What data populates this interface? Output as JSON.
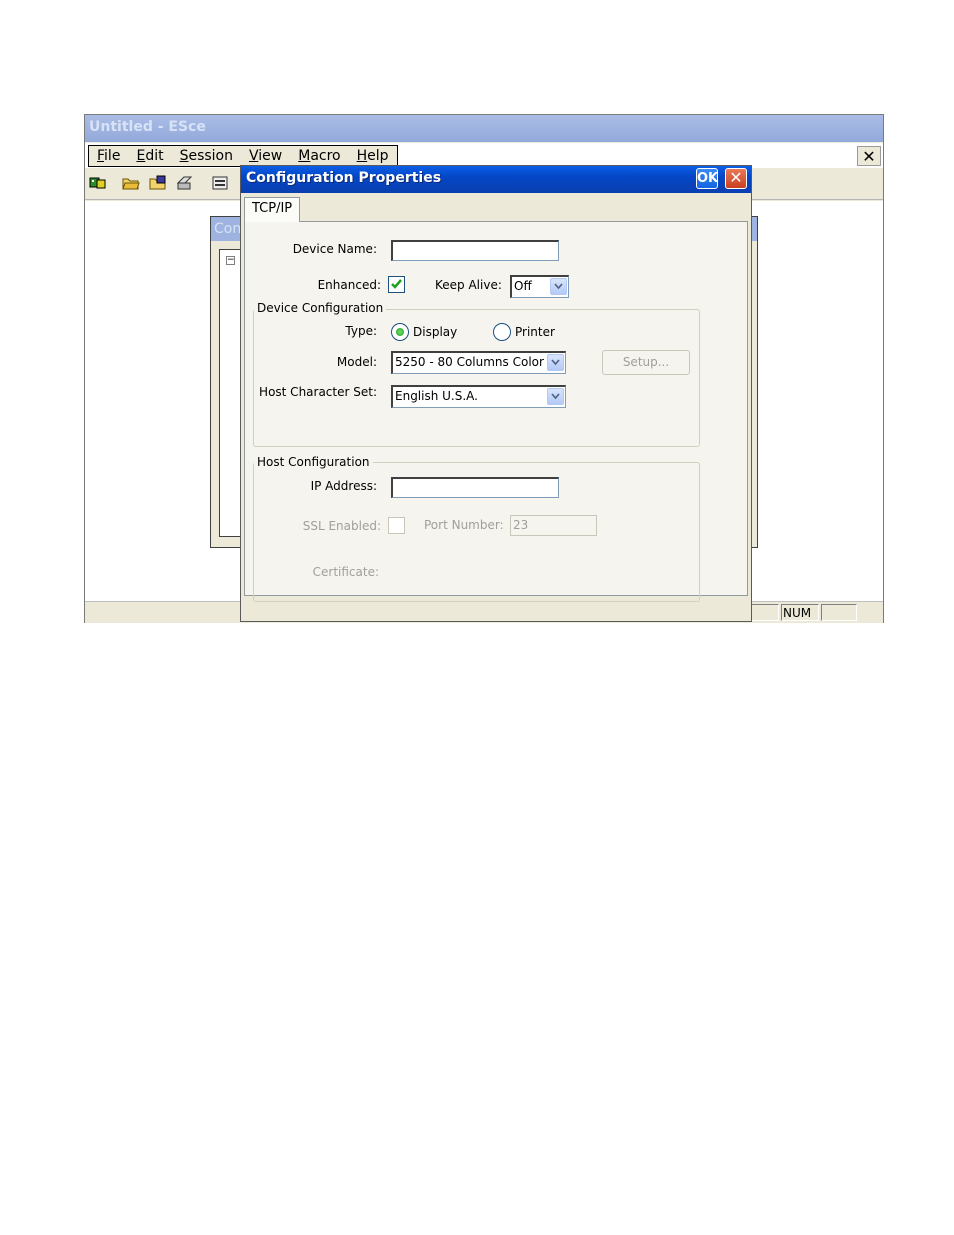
{
  "app": {
    "title": "Untitled - ESce",
    "menu": [
      {
        "accel": "F",
        "rest": "ile"
      },
      {
        "accel": "E",
        "rest": "dit"
      },
      {
        "accel": "S",
        "rest": "ession"
      },
      {
        "accel": "V",
        "rest": "iew"
      },
      {
        "accel": "M",
        "rest": "acro"
      },
      {
        "accel": "H",
        "rest": "elp"
      }
    ],
    "close_glyph": "✕",
    "child_window_title": "Con",
    "tree_toggle": "−",
    "status": {
      "num": "NUM"
    }
  },
  "dialog": {
    "title": "Configuration Properties",
    "ok_label": "OK",
    "close_glyph": "✕",
    "tab": "TCP/IP",
    "device_name": {
      "label": "Device Name:",
      "value": ""
    },
    "enhanced": {
      "label": "Enhanced:",
      "checked": true
    },
    "keep_alive": {
      "label": "Keep Alive:",
      "value": "Off"
    },
    "device_configuration": {
      "title": "Device Configuration",
      "type_label": "Type:",
      "type_options": [
        "Display",
        "Printer"
      ],
      "type_selected": "Display",
      "model_label": "Model:",
      "model_value": "5250 - 80 Columns Color",
      "setup_button": "Setup...",
      "host_charset_label": "Host Character Set:",
      "host_charset_value": "English U.S.A."
    },
    "host_configuration": {
      "title": "Host Configuration",
      "ip_label": "IP Address:",
      "ip_value": "",
      "ssl_label": "SSL Enabled:",
      "ssl_checked": false,
      "port_label": "Port Number:",
      "port_value": "23",
      "certificate_label": "Certificate:"
    }
  },
  "colors": {
    "dialog_title": "#0446c6",
    "inactive_title": "#9fb3e0",
    "radio_selected": "#1f9a1f",
    "checkbox_check": "#21a121"
  }
}
